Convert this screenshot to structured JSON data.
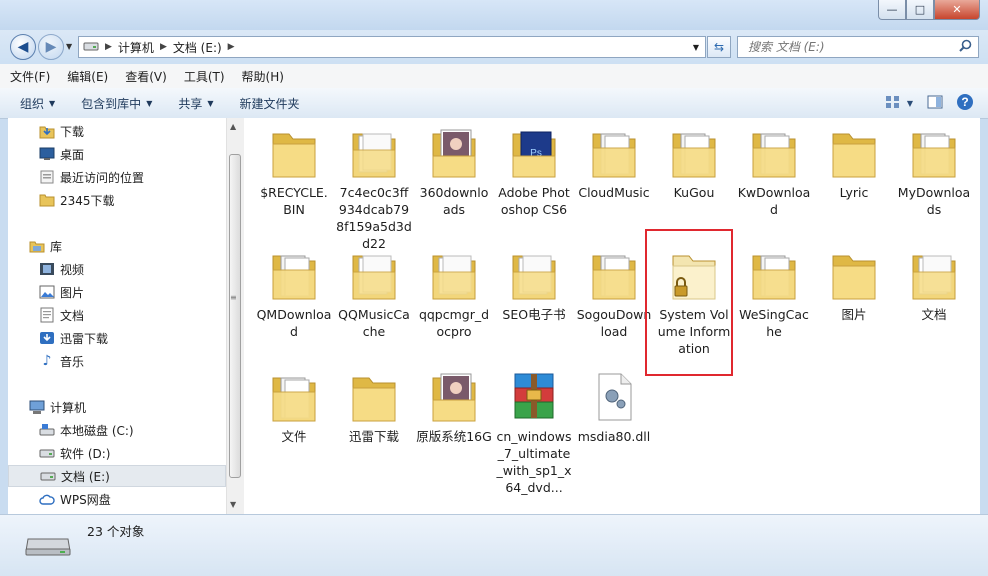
{
  "window": {
    "minimize": "—",
    "maximize": "□",
    "close": "✕"
  },
  "address": {
    "crumbs": [
      "计算机",
      "文档 (E:)"
    ],
    "search_placeholder": "搜索 文档 (E:)"
  },
  "menu": [
    "文件(F)",
    "编辑(E)",
    "查看(V)",
    "工具(T)",
    "帮助(H)"
  ],
  "toolbar": {
    "organize": "组织",
    "include_library": "包含到库中",
    "share": "共享",
    "new_folder": "新建文件夹"
  },
  "sidebar": {
    "favorites": [
      "下载",
      "桌面",
      "最近访问的位置",
      "2345下载"
    ],
    "libraries_label": "库",
    "libraries": [
      "视频",
      "图片",
      "文档",
      "迅雷下载",
      "音乐"
    ],
    "computer_label": "计算机",
    "drives": [
      "本地磁盘 (C:)",
      "软件 (D:)",
      "文档 (E:)",
      "WPS网盘"
    ]
  },
  "files": [
    {
      "name": "$RECYCLE.BIN",
      "icon": "folder-empty-icon"
    },
    {
      "name": "7c4ec0c3ff934dcab798f159a5d3dd22",
      "icon": "folder-docs-icon"
    },
    {
      "name": "360downloads",
      "icon": "folder-photo-icon"
    },
    {
      "name": "Adobe Photoshop CS6",
      "icon": "folder-photoshop-icon"
    },
    {
      "name": "CloudMusic",
      "icon": "folder-files-icon"
    },
    {
      "name": "KuGou",
      "icon": "folder-files-icon"
    },
    {
      "name": "KwDownload",
      "icon": "folder-files-icon"
    },
    {
      "name": "Lyric",
      "icon": "folder-empty-icon"
    },
    {
      "name": "MyDownloads",
      "icon": "folder-files-icon"
    },
    {
      "name": "QMDownload",
      "icon": "folder-files-icon"
    },
    {
      "name": "QQMusicCache",
      "icon": "folder-docs-icon"
    },
    {
      "name": "qqpcmgr_docpro",
      "icon": "folder-docs-icon"
    },
    {
      "name": "SEO电子书",
      "icon": "folder-docs-icon"
    },
    {
      "name": "SogouDownload",
      "icon": "folder-files-icon"
    },
    {
      "name": "System Volume Information",
      "icon": "folder-locked-icon"
    },
    {
      "name": "WeSingCache",
      "icon": "folder-files-icon"
    },
    {
      "name": "图片",
      "icon": "folder-empty-icon"
    },
    {
      "name": "文档",
      "icon": "folder-docs-icon"
    },
    {
      "name": "文件",
      "icon": "folder-files-icon"
    },
    {
      "name": "迅雷下载",
      "icon": "folder-empty-icon"
    },
    {
      "name": "原版系统16G",
      "icon": "folder-photo-icon"
    },
    {
      "name": "cn_windows_7_ultimate_with_sp1_x64_dvd...",
      "icon": "winrar-archive-icon"
    },
    {
      "name": "msdia80.dll",
      "icon": "dll-file-icon"
    }
  ],
  "status": {
    "count": "23 个对象"
  }
}
